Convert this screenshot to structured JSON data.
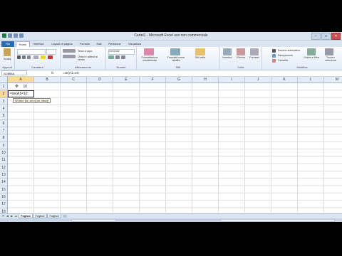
{
  "window": {
    "title": "Cartel1 - Microsoft Excel uso non commerciale",
    "minimize": "–",
    "maximize": "□",
    "close": "✕"
  },
  "tabs": [
    "File",
    "Home",
    "Inserisci",
    "Layout di pagina",
    "Formule",
    "Dati",
    "Revisione",
    "Visualizza"
  ],
  "ribbon": {
    "paste_label": "Incolla",
    "groups": {
      "clipboard": "Appunti",
      "font": "Carattere",
      "alignment": "Allineamento",
      "number": "Numeri",
      "styles": "Stili",
      "cells": "Celle",
      "editing": "Modifica"
    },
    "wrap_text": "Testo a capo",
    "merge_center": "Unisci e allinea al centro",
    "number_format": "Generale",
    "conditional_format": "Formattazione condizionale",
    "format_as_table": "Formatta come tabella",
    "cell_styles": "Stili cella",
    "insert": "Inserisci",
    "delete": "Elimina",
    "format": "Formato",
    "autosum": "Somma automatica",
    "fill": "Riempimento",
    "clear": "Cancella",
    "sort_filter": "Ordina e filtra",
    "find_select": "Trova e seleziona"
  },
  "formula_bar": {
    "name_box": "SOMMA",
    "fx": "fx",
    "formula": "=se(A1=10;"
  },
  "columns": [
    "A",
    "B",
    "C",
    "D",
    "E",
    "F",
    "G",
    "H",
    "I",
    "J",
    "K",
    "L",
    "M",
    "N"
  ],
  "rows": [
    "1",
    "2",
    "3",
    "4",
    "5",
    "6",
    "7",
    "8",
    "9",
    "10",
    "11",
    "12",
    "13",
    "14",
    "15",
    "16",
    "17",
    "18"
  ],
  "cells": {
    "A1": "10",
    "A2": "=se(A1=10;"
  },
  "tooltip": "SE(test; [se_vero]; [se_falso])",
  "sheets": [
    "Foglio1",
    "Foglio2",
    "Foglio3"
  ],
  "active_sheet": "Foglio1",
  "colors": {
    "selection_header": "#f9d99c",
    "header_bg": "#e4ecf7",
    "file_tab": "#2a6bb5"
  }
}
